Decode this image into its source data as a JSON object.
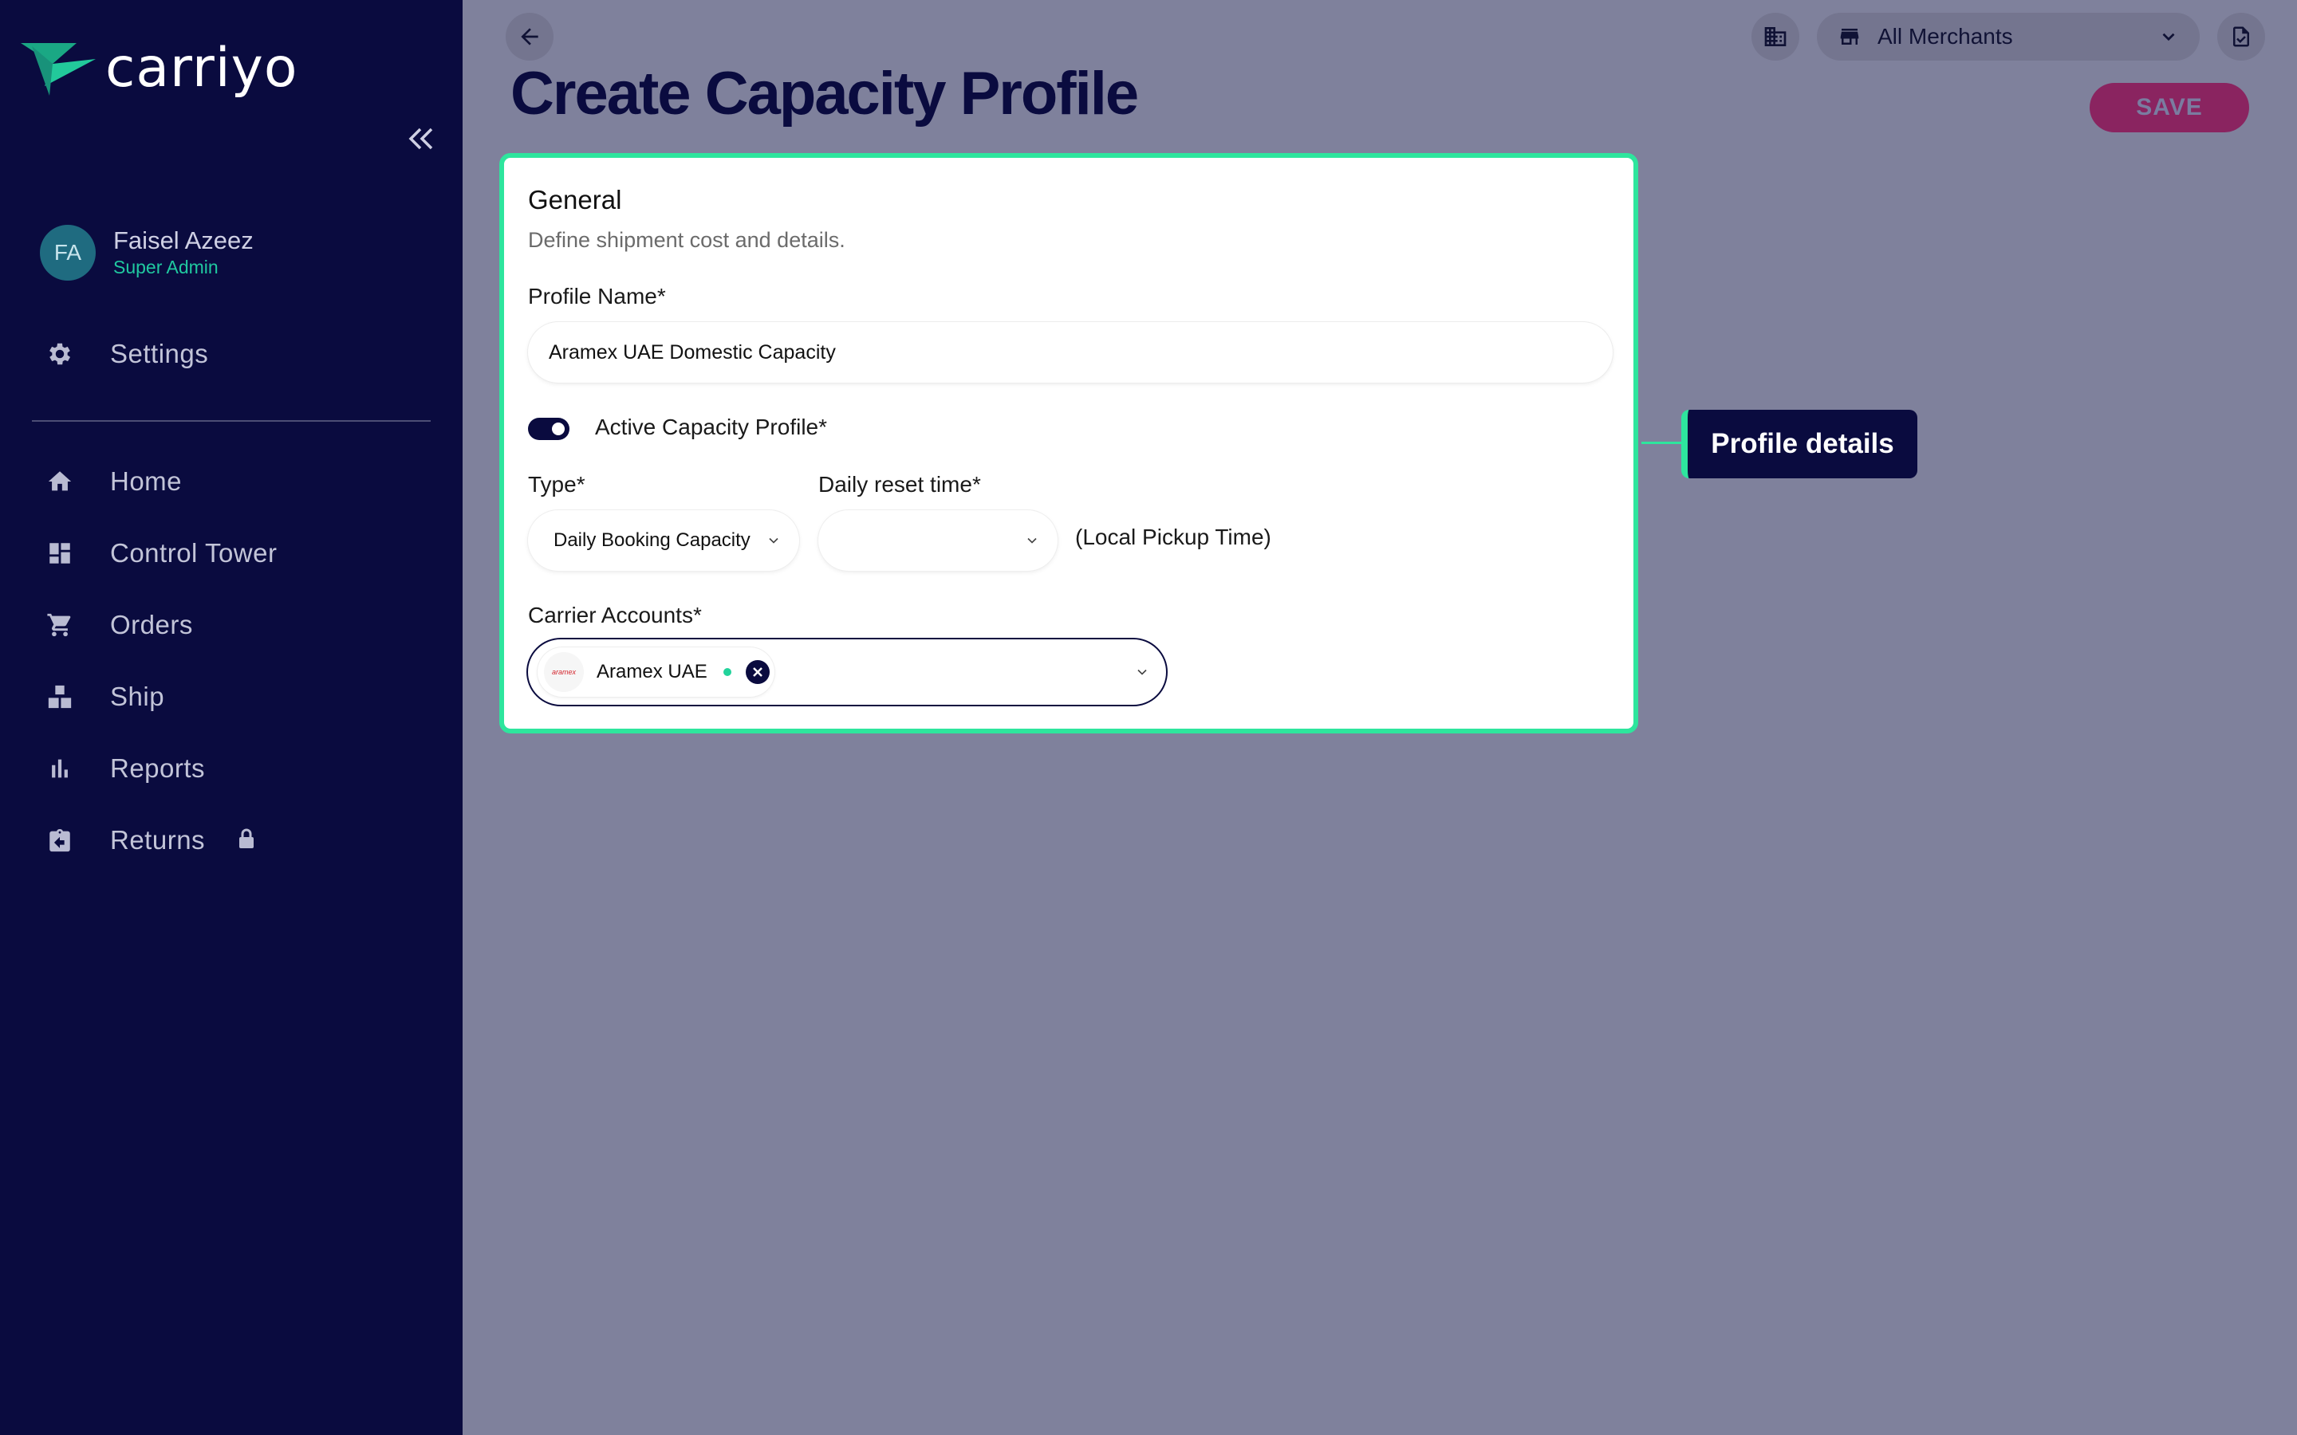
{
  "brand": {
    "name": "carriyo"
  },
  "user": {
    "initials": "FA",
    "name": "Faisel Azeez",
    "role": "Super Admin"
  },
  "sidebar": {
    "settings": {
      "label": "Settings",
      "icon": "gear-icon"
    },
    "items": [
      {
        "label": "Home",
        "icon": "home-icon"
      },
      {
        "label": "Control Tower",
        "icon": "dashboard-icon"
      },
      {
        "label": "Orders",
        "icon": "cart-icon"
      },
      {
        "label": "Ship",
        "icon": "boxes-icon"
      },
      {
        "label": "Reports",
        "icon": "bar-chart-icon"
      },
      {
        "label": "Returns",
        "icon": "returns-icon",
        "locked": true
      }
    ]
  },
  "topbar": {
    "merchant": "All Merchants"
  },
  "page": {
    "title": "Create Capacity Profile",
    "save_label": "SAVE"
  },
  "general": {
    "title": "General",
    "subtitle": "Define shipment cost and details.",
    "profile_name_label": "Profile Name*",
    "profile_name_value": "Aramex UAE Domestic Capacity",
    "active_label": "Active Capacity Profile*",
    "active": true,
    "type_label": "Type*",
    "type_value": "Daily Booking Capacity",
    "reset_label": "Daily reset time*",
    "reset_value": "",
    "reset_suffix": "(Local Pickup Time)",
    "carrier_label": "Carrier Accounts*",
    "carrier_chip": "Aramex UAE",
    "carrier_logo_text": "aramex"
  },
  "callout": {
    "label": "Profile details"
  },
  "colors": {
    "sidebar_bg": "#0a0b3f",
    "accent_green": "#2ee59d",
    "save_button": "#8a2460",
    "overlay": "#7f819c"
  }
}
